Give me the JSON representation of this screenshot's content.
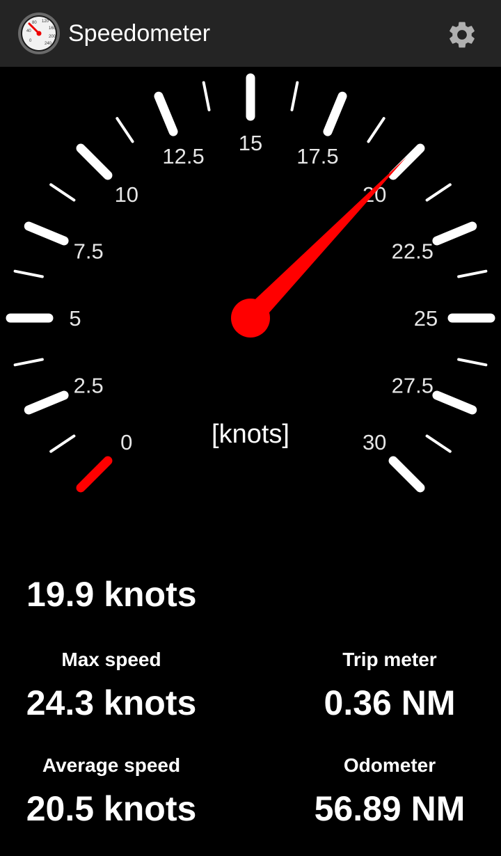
{
  "app": {
    "title": "Speedometer",
    "icon": "speedometer-app-icon",
    "settings_icon": "gear-icon"
  },
  "gauge": {
    "unit_label": "[knots]",
    "min": 0,
    "max": 30,
    "major_step": 2.5,
    "tick_labels": [
      "0",
      "2.5",
      "5",
      "7.5",
      "10",
      "12.5",
      "15",
      "17.5",
      "20",
      "22.5",
      "25",
      "27.5",
      "30"
    ],
    "needle_value": 19.9,
    "needle_color": "#ff0000",
    "tick_color": "#ffffff"
  },
  "readouts": {
    "current_speed": "19.9 knots",
    "max_speed_label": "Max speed",
    "max_speed_value": "24.3 knots",
    "trip_label": "Trip meter",
    "trip_value": "0.36 NM",
    "avg_speed_label": "Average speed",
    "avg_speed_value": "20.5 knots",
    "odometer_label": "Odometer",
    "odometer_value": "56.89 NM"
  }
}
